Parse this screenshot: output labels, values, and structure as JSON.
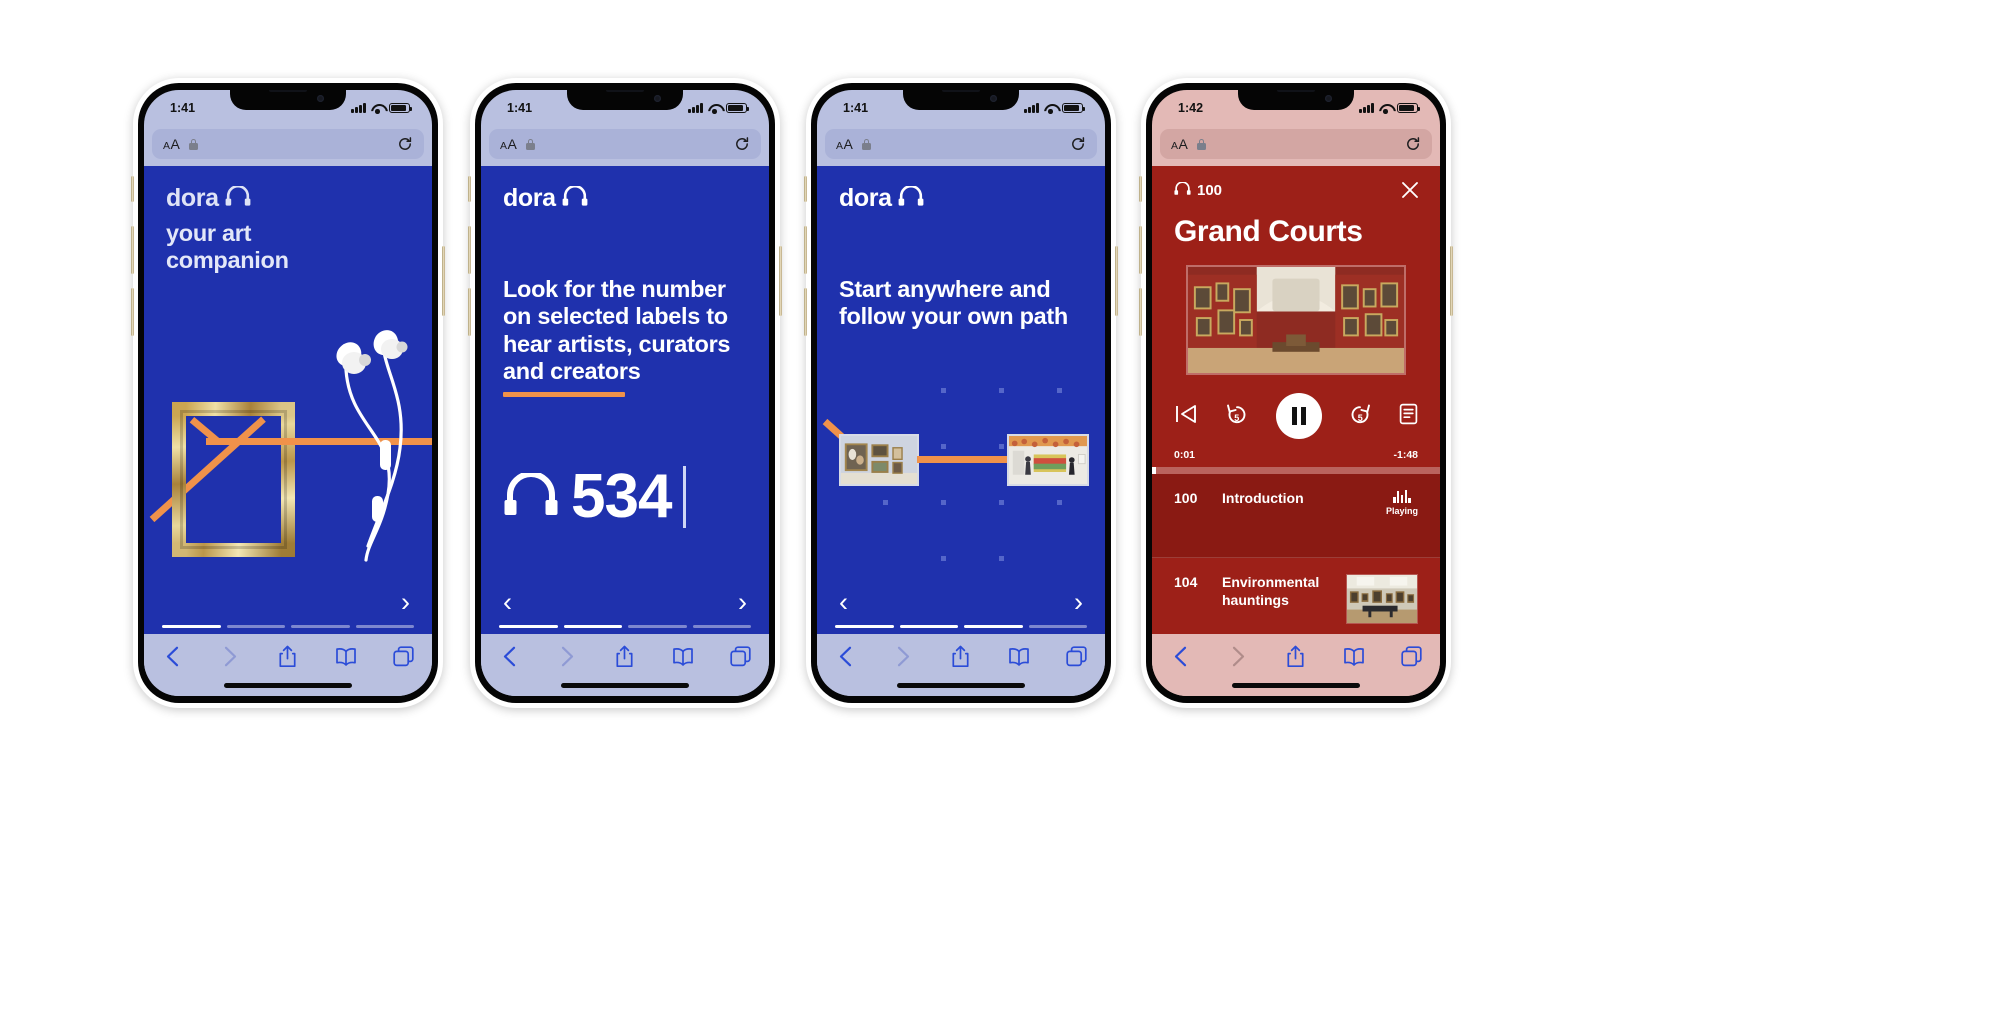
{
  "phones": [
    {
      "id": "phone-onboarding-1",
      "status": {
        "time": "1:41",
        "signal_icon": "cellular-signal-icon",
        "wifi_icon": "wifi-icon",
        "battery_icon": "battery-icon"
      },
      "browser": {
        "aa_label": "AA",
        "lock_icon": "lock-icon",
        "reload_icon": "reload-icon",
        "toolbar": [
          "back-icon",
          "forward-icon",
          "share-icon",
          "bookmarks-icon",
          "tabs-icon"
        ]
      },
      "content": {
        "brand": "dora",
        "brand_icon": "headphones-icon",
        "headline": "your art\ncompanion",
        "illustration": "gold-picture-frame-with-earbuds",
        "next_label": "›",
        "progress_steps": 4,
        "progress_active": 1
      }
    },
    {
      "id": "phone-onboarding-2",
      "status": {
        "time": "1:41",
        "signal_icon": "cellular-signal-icon",
        "wifi_icon": "wifi-icon",
        "battery_icon": "battery-icon"
      },
      "browser": {
        "aa_label": "AA",
        "lock_icon": "lock-icon",
        "reload_icon": "reload-icon",
        "toolbar": [
          "back-icon",
          "forward-icon",
          "share-icon",
          "bookmarks-icon",
          "tabs-icon"
        ]
      },
      "content": {
        "brand": "dora",
        "brand_icon": "headphones-icon",
        "headline": "Look for the number on selected labels to hear artists, curators and creators",
        "rule_color": "#f0924a",
        "number_icon": "headphones-icon",
        "number": "534",
        "prev_label": "‹",
        "next_label": "›",
        "progress_steps": 4,
        "progress_active": 2
      }
    },
    {
      "id": "phone-onboarding-3",
      "status": {
        "time": "1:41",
        "signal_icon": "cellular-signal-icon",
        "wifi_icon": "wifi-icon",
        "battery_icon": "battery-icon"
      },
      "browser": {
        "aa_label": "AA",
        "lock_icon": "lock-icon",
        "reload_icon": "reload-icon",
        "toolbar": [
          "back-icon",
          "forward-icon",
          "share-icon",
          "bookmarks-icon",
          "tabs-icon"
        ]
      },
      "content": {
        "brand": "dora",
        "brand_icon": "headphones-icon",
        "headline": "Start anywhere and follow your own path",
        "map": {
          "path_color": "#f0924a",
          "thumbs": [
            "gallery-portraits-thumbnail",
            "gallery-colorfield-thumbnail"
          ],
          "dot_color": "#5566c9"
        },
        "prev_label": "‹",
        "next_label": "›",
        "progress_steps": 4,
        "progress_active": 3
      }
    },
    {
      "id": "phone-player-4",
      "status": {
        "time": "1:42",
        "signal_icon": "cellular-signal-icon",
        "wifi_icon": "wifi-icon",
        "battery_icon": "battery-icon"
      },
      "browser": {
        "aa_label": "AA",
        "lock_icon": "lock-icon",
        "reload_icon": "reload-icon",
        "toolbar": [
          "back-icon",
          "forward-icon",
          "share-icon",
          "bookmarks-icon",
          "tabs-icon"
        ]
      },
      "player": {
        "track_icon": "headphones-icon",
        "track_number": "100",
        "close_icon": "close-icon",
        "title": "Grand Courts",
        "hero_image": "grand-courts-gallery-photo",
        "controls": {
          "previous_icon": "skip-previous-icon",
          "rewind_icon": "rewind-5-icon",
          "rewind_label": "5",
          "play_pause_icon": "pause-icon",
          "forward_icon": "forward-5-icon",
          "forward_label": "5",
          "transcript_icon": "transcript-icon"
        },
        "elapsed": "0:01",
        "remaining": "-1:48",
        "progress_percent": 1,
        "tracks": [
          {
            "number": "100",
            "name": "Introduction",
            "status_icon": "equalizer-icon",
            "status_label": "Playing",
            "is_current": true,
            "thumbnail": null
          },
          {
            "number": "104",
            "name": "Environmental hauntings",
            "status_icon": null,
            "status_label": null,
            "is_current": false,
            "thumbnail": "gallery-room-thumbnail"
          }
        ]
      }
    }
  ],
  "colors": {
    "brand_blue": "#1f31ad",
    "accent_orange": "#f0924a",
    "player_red": "#9d2018",
    "player_red_active": "#8a1a13",
    "chrome_blue": "#b9c0e0",
    "chrome_pink": "#e3b9b6"
  }
}
